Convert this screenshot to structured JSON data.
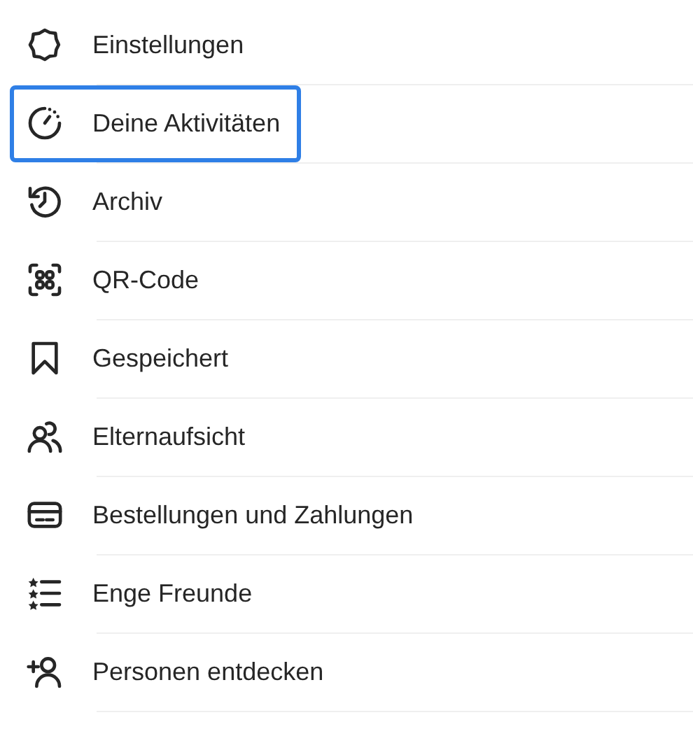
{
  "menu": {
    "items": [
      {
        "kind": "gear",
        "label": "Einstellungen",
        "highlighted": false
      },
      {
        "kind": "activity",
        "label": "Deine Aktivitäten",
        "highlighted": true
      },
      {
        "kind": "archive",
        "label": "Archiv",
        "highlighted": false
      },
      {
        "kind": "qr",
        "label": "QR-Code",
        "highlighted": false
      },
      {
        "kind": "bookmark",
        "label": "Gespeichert",
        "highlighted": false
      },
      {
        "kind": "people",
        "label": "Elternaufsicht",
        "highlighted": false
      },
      {
        "kind": "card",
        "label": "Bestellungen und Zahlungen",
        "highlighted": false
      },
      {
        "kind": "starlist",
        "label": "Enge Freunde",
        "highlighted": false
      },
      {
        "kind": "addperson",
        "label": "Personen entdecken",
        "highlighted": false
      }
    ]
  }
}
